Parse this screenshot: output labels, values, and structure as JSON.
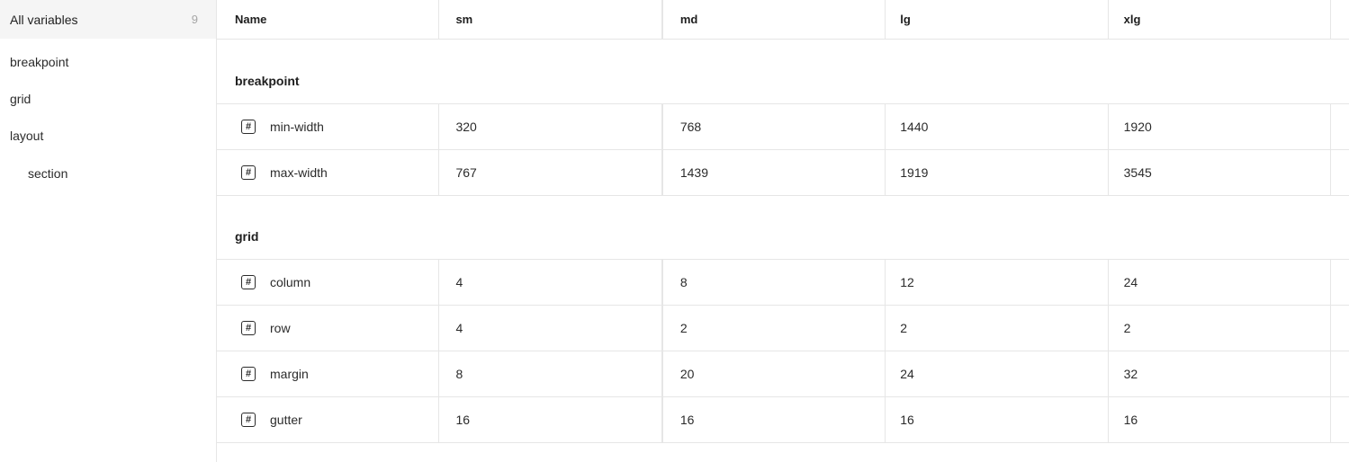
{
  "sidebar": {
    "title": "All variables",
    "count": "9",
    "items": [
      {
        "label": "breakpoint",
        "child": false
      },
      {
        "label": "grid",
        "child": false
      },
      {
        "label": "layout",
        "child": false
      },
      {
        "label": "section",
        "child": true
      }
    ]
  },
  "table": {
    "columns": [
      "Name",
      "sm",
      "md",
      "lg",
      "xlg"
    ],
    "groups": [
      {
        "name": "breakpoint",
        "rows": [
          {
            "name": "min-width",
            "values": [
              "320",
              "768",
              "1440",
              "1920"
            ]
          },
          {
            "name": "max-width",
            "values": [
              "767",
              "1439",
              "1919",
              "3545"
            ]
          }
        ]
      },
      {
        "name": "grid",
        "rows": [
          {
            "name": "column",
            "values": [
              "4",
              "8",
              "12",
              "24"
            ]
          },
          {
            "name": "row",
            "values": [
              "4",
              "2",
              "2",
              "2"
            ]
          },
          {
            "name": "margin",
            "values": [
              "8",
              "20",
              "24",
              "32"
            ]
          },
          {
            "name": "gutter",
            "values": [
              "16",
              "16",
              "16",
              "16"
            ]
          }
        ]
      }
    ],
    "row_icon": "number-variable-icon",
    "row_icon_glyph": "#"
  }
}
